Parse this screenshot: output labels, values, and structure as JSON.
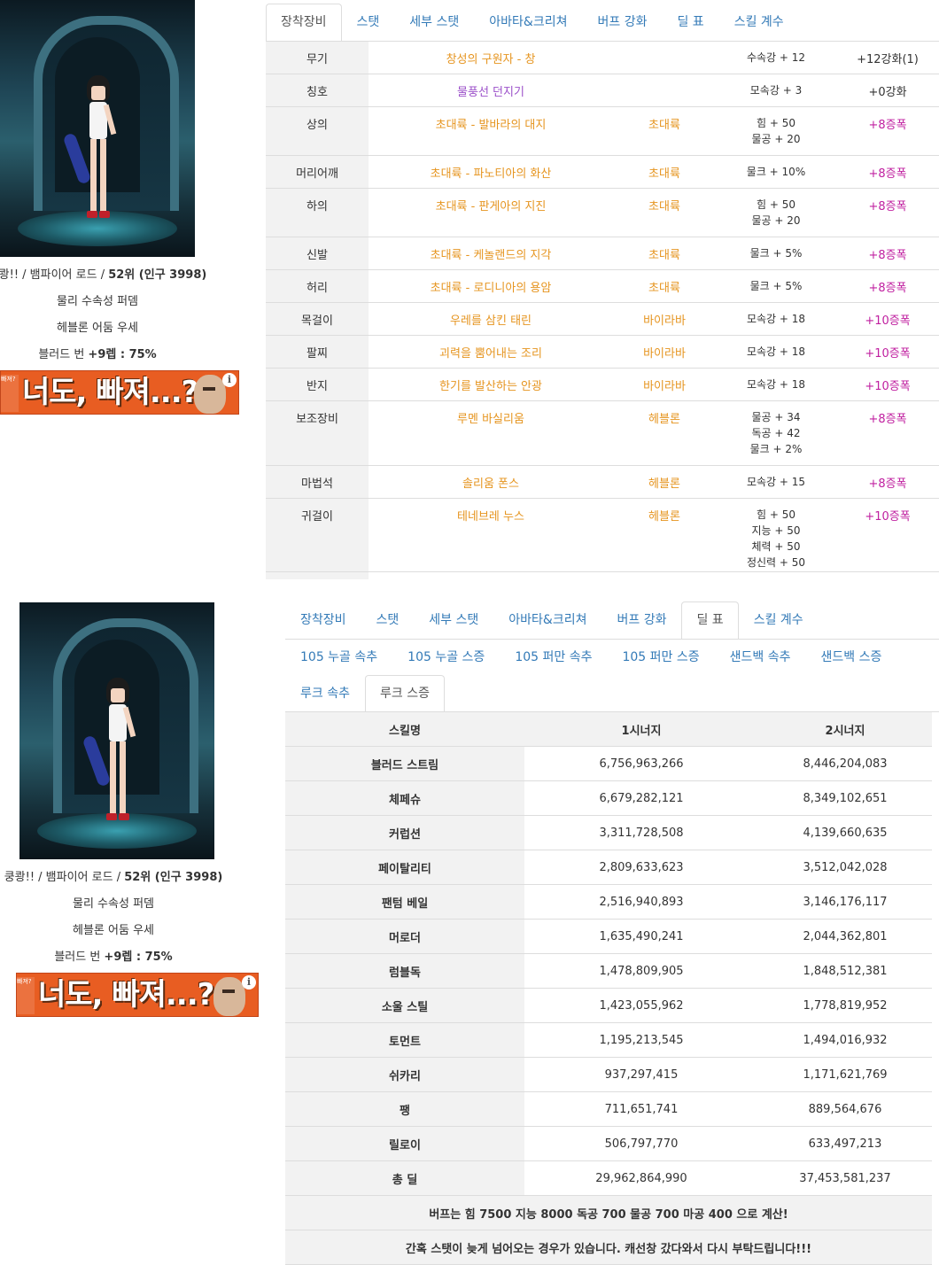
{
  "character": {
    "info_name": "쿵쾅!! / 뱀파이어 로드 / ",
    "info_rank": "52위 (인구 3998)",
    "weapon_desc": "물리 수속성 퍼뎀",
    "avatar_desc": "헤블론 어둠 우세",
    "skill_label": "블러드 번 ",
    "skill_value": "+9렙 : 75%"
  },
  "ad": {
    "text": "너도, 빠져...?",
    "side_text": "빠져?",
    "info_glyph": "i"
  },
  "tabs": [
    "장착장비",
    "스탯",
    "세부 스탯",
    "아바타&크리쳐",
    "버프 강화",
    "딜 표",
    "스킬 계수"
  ],
  "sec1_active_tab": "장착장비",
  "sec2_active_tab": "딜 표",
  "subtabs_row1": [
    "105 누골 속추",
    "105 누골 스증",
    "105 퍼만 속추",
    "105 퍼만 스증",
    "샌드백 속추",
    "샌드백 스증"
  ],
  "subtabs_row2": [
    "루크 속추",
    "루크 스증"
  ],
  "equipment": [
    {
      "slot": "무기",
      "name": "창성의 구원자 - 창",
      "name_color": "orange",
      "set": "",
      "options": [
        "수속강 + 12"
      ],
      "reinforce": "+12강화(1)",
      "reinforce_plain": true
    },
    {
      "slot": "칭호",
      "name": "물풍선 던지기",
      "name_color": "purple",
      "set": "",
      "options": [
        "모속강 + 3"
      ],
      "reinforce": "+0강화",
      "reinforce_plain": true
    },
    {
      "slot": "상의",
      "name": "초대륙 - 발바라의 대지",
      "name_color": "orange",
      "set": "초대륙",
      "options": [
        "힘 + 50",
        "물공 + 20"
      ],
      "reinforce": "+8증폭",
      "reinforce_plain": false
    },
    {
      "slot": "머리어깨",
      "name": "초대륙 - 파노티아의 화산",
      "name_color": "orange",
      "set": "초대륙",
      "options": [
        "물크 + 10%"
      ],
      "reinforce": "+8증폭",
      "reinforce_plain": false
    },
    {
      "slot": "하의",
      "name": "초대륙 - 판게아의 지진",
      "name_color": "orange",
      "set": "초대륙",
      "options": [
        "힘 + 50",
        "물공 + 20"
      ],
      "reinforce": "+8증폭",
      "reinforce_plain": false
    },
    {
      "slot": "신발",
      "name": "초대륙 - 케놀랜드의 지각",
      "name_color": "orange",
      "set": "초대륙",
      "options": [
        "물크 + 5%"
      ],
      "reinforce": "+8증폭",
      "reinforce_plain": false
    },
    {
      "slot": "허리",
      "name": "초대륙 - 로디니아의 용암",
      "name_color": "orange",
      "set": "초대륙",
      "options": [
        "물크 + 5%"
      ],
      "reinforce": "+8증폭",
      "reinforce_plain": false
    },
    {
      "slot": "목걸이",
      "name": "우레를 삼킨 태린",
      "name_color": "orange",
      "set": "바이라바",
      "options": [
        "모속강 + 18"
      ],
      "reinforce": "+10증폭",
      "reinforce_plain": false
    },
    {
      "slot": "팔찌",
      "name": "괴력을 뿜어내는 조리",
      "name_color": "orange",
      "set": "바이라바",
      "options": [
        "모속강 + 18"
      ],
      "reinforce": "+10증폭",
      "reinforce_plain": false
    },
    {
      "slot": "반지",
      "name": "한기를 발산하는 안광",
      "name_color": "orange",
      "set": "바이라바",
      "options": [
        "모속강 + 18"
      ],
      "reinforce": "+10증폭",
      "reinforce_plain": false
    },
    {
      "slot": "보조장비",
      "name": "루멘 바실리움",
      "name_color": "orange",
      "set": "헤블론",
      "options": [
        "물공 + 34",
        "독공 + 42",
        "물크 + 2%"
      ],
      "reinforce": "+8증폭",
      "reinforce_plain": false
    },
    {
      "slot": "마법석",
      "name": "솔리움 폰스",
      "name_color": "orange",
      "set": "헤블론",
      "options": [
        "모속강 + 15"
      ],
      "reinforce": "+8증폭",
      "reinforce_plain": false
    },
    {
      "slot": "귀걸이",
      "name": "테네브레 누스",
      "name_color": "orange",
      "set": "헤블론",
      "options": [
        "힘 + 50",
        "지능 + 50",
        "체력 + 50",
        "정신력 + 50"
      ],
      "reinforce": "+10증폭",
      "reinforce_plain": false
    }
  ],
  "damage": {
    "headers": [
      "스킬명",
      "1시너지",
      "2시너지"
    ],
    "rows": [
      {
        "skill": "블러드 스트림",
        "v1": "6,756,963,266",
        "v2": "8,446,204,083"
      },
      {
        "skill": "체페슈",
        "v1": "6,679,282,121",
        "v2": "8,349,102,651"
      },
      {
        "skill": "커럽션",
        "v1": "3,311,728,508",
        "v2": "4,139,660,635"
      },
      {
        "skill": "페이탈리티",
        "v1": "2,809,633,623",
        "v2": "3,512,042,028"
      },
      {
        "skill": "팬텀 베일",
        "v1": "2,516,940,893",
        "v2": "3,146,176,117"
      },
      {
        "skill": "머로더",
        "v1": "1,635,490,241",
        "v2": "2,044,362,801"
      },
      {
        "skill": "럼블독",
        "v1": "1,478,809,905",
        "v2": "1,848,512,381"
      },
      {
        "skill": "소울 스틸",
        "v1": "1,423,055,962",
        "v2": "1,778,819,952"
      },
      {
        "skill": "토먼트",
        "v1": "1,195,213,545",
        "v2": "1,494,016,932"
      },
      {
        "skill": "쉬카리",
        "v1": "937,297,415",
        "v2": "1,171,621,769"
      },
      {
        "skill": "팽",
        "v1": "711,651,741",
        "v2": "889,564,676"
      },
      {
        "skill": "릴로이",
        "v1": "506,797,770",
        "v2": "633,497,213"
      },
      {
        "skill": "총 딜",
        "v1": "29,962,864,990",
        "v2": "37,453,581,237"
      }
    ],
    "note1": "버프는 힘 7500 지능 8000 독공 700 물공 700 마공 400 으로 계산!",
    "note2": "간혹 스탯이 늦게 넘어오는 경우가 있습니다. 캐선창 갔다와서 다시 부탁드립니다!!!"
  }
}
